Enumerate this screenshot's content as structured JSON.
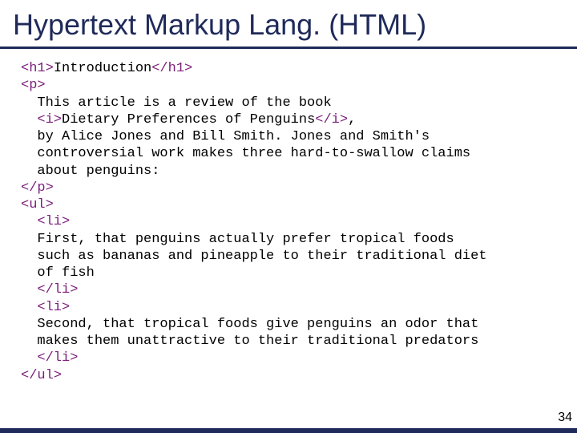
{
  "title": "Hypertext Markup Lang. (HTML)",
  "pagenum": "34",
  "code": {
    "l01a": "<h1>",
    "l01b": "Introduction",
    "l01c": "</h1>",
    "l02": "<p>",
    "l03": "  This article is a review of the book",
    "l04a": "  ",
    "l04b": "<i>",
    "l04c": "Dietary Preferences of Penguins",
    "l04d": "</i>",
    "l04e": ",",
    "l05": "  by Alice Jones and Bill Smith. Jones and Smith's",
    "l06": "  controversial work makes three hard-to-swallow claims",
    "l07": "  about penguins:",
    "l08": "</p>",
    "l09": "<ul>",
    "l10": "  <li>",
    "l11": "  First, that penguins actually prefer tropical foods",
    "l12": "  such as bananas and pineapple to their traditional diet",
    "l13": "  of fish",
    "l14": "  </li>",
    "l15": "  <li>",
    "l16": "  Second, that tropical foods give penguins an odor that",
    "l17": "  makes them unattractive to their traditional predators",
    "l18": "  </li>",
    "l19": "</ul>"
  }
}
